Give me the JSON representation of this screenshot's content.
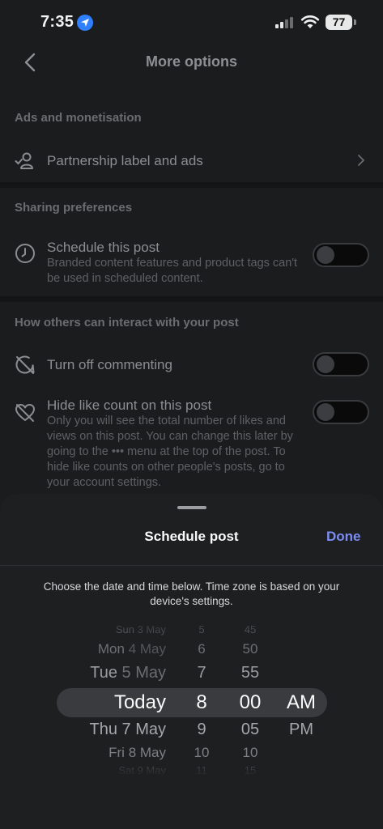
{
  "status": {
    "time": "7:35",
    "battery": "77"
  },
  "nav": {
    "title": "More options"
  },
  "sections": {
    "ads": {
      "header": "Ads and monetisation",
      "partnership_label": "Partnership label and ads"
    },
    "sharing": {
      "header": "Sharing preferences",
      "schedule_title": "Schedule this post",
      "schedule_sub": "Branded content features and product tags can't be used in scheduled content.",
      "schedule_on": false
    },
    "interact": {
      "header": "How others can interact with your post",
      "commenting_title": "Turn off commenting",
      "commenting_on": false,
      "hide_like_title": "Hide like count on this post",
      "hide_like_sub": "Only you will see the total number of likes and views on this post. You can change this later by going to the ••• menu at the top of the post. To hide like counts on other people's posts, go to your account settings.",
      "hide_like_on": false
    }
  },
  "sheet": {
    "title": "Schedule post",
    "done_label": "Done",
    "description": "Choose the date and time below. Time zone is based on your device's settings.",
    "picker": {
      "dates": [
        {
          "day": "Sun",
          "date": "3 May"
        },
        {
          "day": "Mon",
          "date": "4 May"
        },
        {
          "day": "Tue",
          "date": "5 May"
        },
        {
          "day": "Today",
          "date": ""
        },
        {
          "day": "Thu",
          "date": "7 May"
        },
        {
          "day": "Fri",
          "date": "8 May"
        },
        {
          "day": "Sat",
          "date": "9 May"
        }
      ],
      "hours": [
        "5",
        "6",
        "7",
        "8",
        "9",
        "10",
        "11"
      ],
      "minutes": [
        "45",
        "50",
        "55",
        "00",
        "05",
        "10",
        "15"
      ],
      "ampm": [
        "",
        "",
        "",
        "AM",
        "PM",
        "",
        ""
      ],
      "selected": {
        "date": "Today",
        "hour": "8",
        "minute": "00",
        "ampm": "AM"
      }
    }
  },
  "colors": {
    "accent": "#7d8cf0",
    "location": "#2f80ff"
  }
}
